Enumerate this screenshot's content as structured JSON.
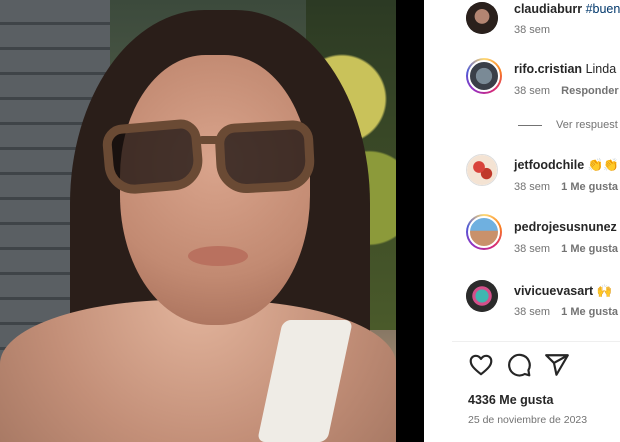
{
  "comments": [
    {
      "username": "claudiaburr",
      "text": "",
      "hashtag": "#buen",
      "time": "38 sem",
      "likes": "",
      "reply": ""
    },
    {
      "username": "rifo.cristian",
      "text": "Linda",
      "time": "38 sem",
      "likes": "",
      "reply": "Responder"
    },
    {
      "username": "jetfoodchile",
      "text": "👏👏",
      "time": "38 sem",
      "likes": "1 Me gusta",
      "reply": ""
    },
    {
      "username": "pedrojesusnunez",
      "text": "",
      "time": "38 sem",
      "likes": "1 Me gusta",
      "reply": ""
    },
    {
      "username": "vivicuevasart",
      "text": "🙌",
      "time": "38 sem",
      "likes": "1 Me gusta",
      "reply": ""
    }
  ],
  "view_replies": "Ver respuest",
  "actions": {
    "like_icon": "heart-icon",
    "comment_icon": "comment-icon",
    "share_icon": "share-icon"
  },
  "likes_count": "4336 Me gusta",
  "post_date": "25 de noviembre de 2023",
  "colors": {
    "text": "#262626",
    "secondary": "#737373",
    "link": "#00376b",
    "story_ring": "#d62976"
  }
}
